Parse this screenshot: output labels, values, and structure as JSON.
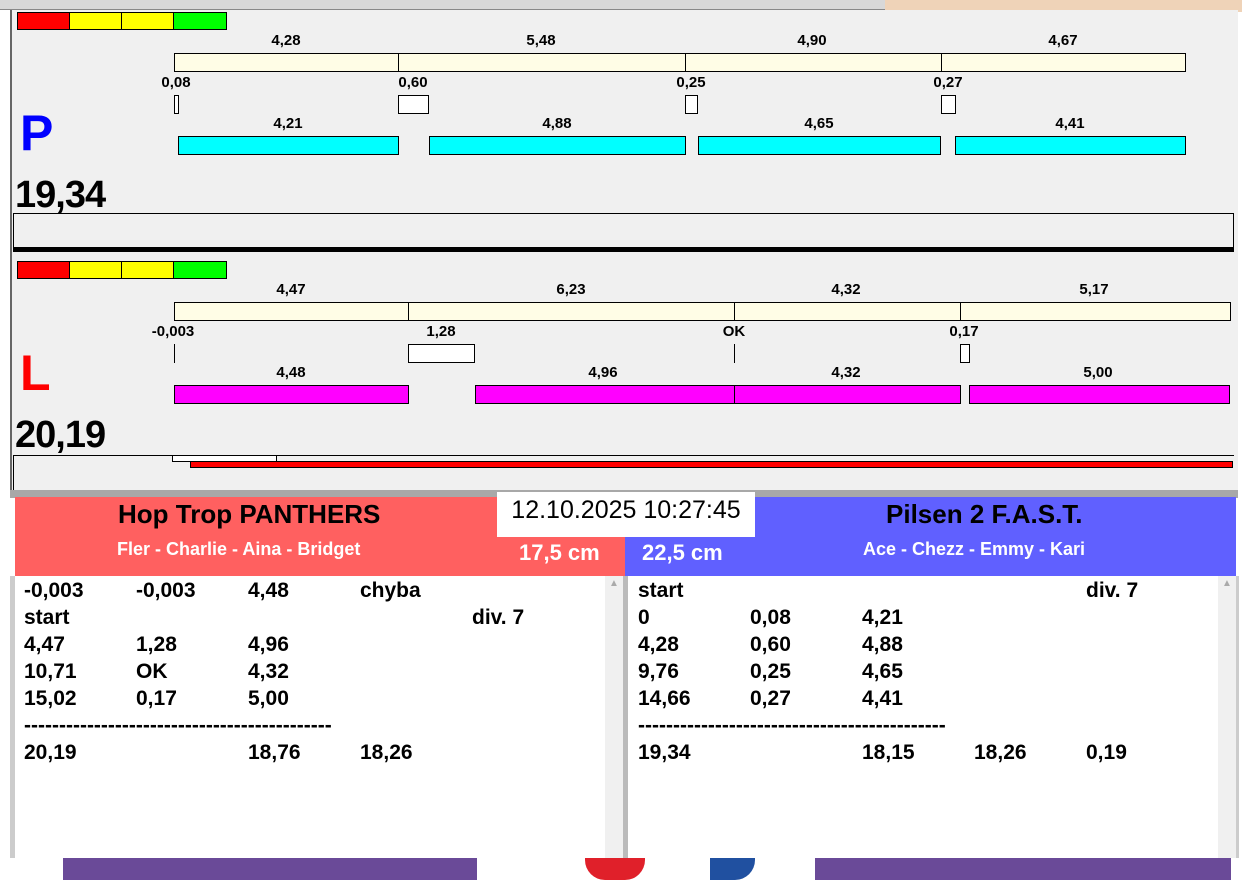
{
  "colors": {
    "red_team": "#ff6060",
    "blue_team": "#6060ff",
    "cyan": "#00ffff",
    "magenta": "#ff00ff",
    "cream": "#fffde6"
  },
  "p": {
    "letter": "P",
    "total": "19,34",
    "top_labels": [
      "4,28",
      "5,48",
      "4,90",
      "4,67"
    ],
    "gap_labels": [
      "0,08",
      "0,60",
      "0,25",
      "0,27"
    ],
    "bar_labels": [
      "4,21",
      "4,88",
      "4,65",
      "4,41"
    ]
  },
  "l": {
    "letter": "L",
    "total": "20,19",
    "top_labels": [
      "4,47",
      "6,23",
      "4,32",
      "5,17"
    ],
    "gap_labels": [
      "-0,003",
      "1,28",
      "OK",
      "0,17"
    ],
    "bar_labels": [
      "4,48",
      "4,96",
      "4,32",
      "5,00"
    ]
  },
  "datetime": "12.10.2025 10:27:45",
  "left_team": {
    "name": "Hop Trop PANTHERS",
    "members": "Fler - Charlie - Aina - Bridget",
    "height": "17,5 cm",
    "rows": [
      [
        "-0,003",
        "-0,003",
        "4,48",
        "chyba",
        ""
      ],
      [
        "start",
        "",
        "",
        "",
        "div.  7"
      ],
      [
        "4,47",
        "1,28",
        "4,96",
        "",
        ""
      ],
      [
        "10,71",
        "OK",
        "4,32",
        "",
        ""
      ],
      [
        "15,02",
        "0,17",
        "5,00",
        "",
        ""
      ],
      [
        "--------------------------------------------",
        "",
        "",
        "",
        ""
      ],
      [
        "20,19",
        "",
        "18,76",
        "18,26",
        ""
      ]
    ]
  },
  "right_team": {
    "name": "Pilsen 2 F.A.S.T.",
    "members": "Ace - Chezz - Emmy - Kari",
    "height": "22,5 cm",
    "rows": [
      [
        "start",
        "",
        "",
        "",
        "div.  7"
      ],
      [
        "0",
        "0,08",
        "4,21",
        "",
        ""
      ],
      [
        "4,28",
        "0,60",
        "4,88",
        "",
        ""
      ],
      [
        "9,76",
        "0,25",
        "4,65",
        "",
        ""
      ],
      [
        "14,66",
        "0,27",
        "4,41",
        "",
        ""
      ],
      [
        "--------------------------------------------",
        "",
        "",
        "",
        ""
      ],
      [
        "19,34",
        "",
        "18,15",
        "18,26",
        "0,19"
      ]
    ]
  }
}
